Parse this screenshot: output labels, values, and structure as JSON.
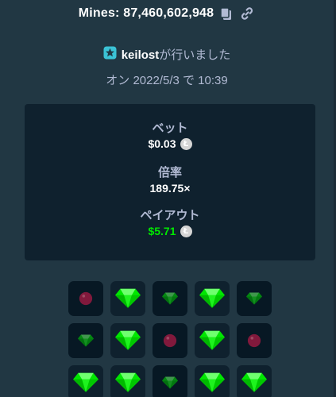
{
  "header": {
    "title": "Mines: 87,460,602,948",
    "copy_icon": "copy-icon",
    "link_icon": "link-icon"
  },
  "user": {
    "icon": "vip-star-icon",
    "name": "keilost",
    "action": "が行いました"
  },
  "date": "オン 2022/5/3 で 10:39",
  "stats": {
    "bet_label": "ベット",
    "bet_value": "$0.03",
    "multiplier_label": "倍率",
    "multiplier_value": "189.75×",
    "payout_label": "ペイアウト",
    "payout_value": "$5.71",
    "currency_icon": "litecoin-icon"
  },
  "grid": {
    "columns": 5,
    "tiles": [
      "mine-small",
      "gem-large",
      "gem-small",
      "gem-large",
      "gem-small",
      "gem-small",
      "gem-large",
      "mine-small",
      "gem-large",
      "mine-small",
      "gem-large",
      "gem-large",
      "gem-small",
      "gem-large",
      "gem-large"
    ]
  },
  "colors": {
    "background": "#213743",
    "panel": "#0f212e",
    "gem": "#00e701",
    "mine": "#d21b4d",
    "muted_text": "#b1bad3",
    "accent_icon": "#3bc3d6"
  }
}
